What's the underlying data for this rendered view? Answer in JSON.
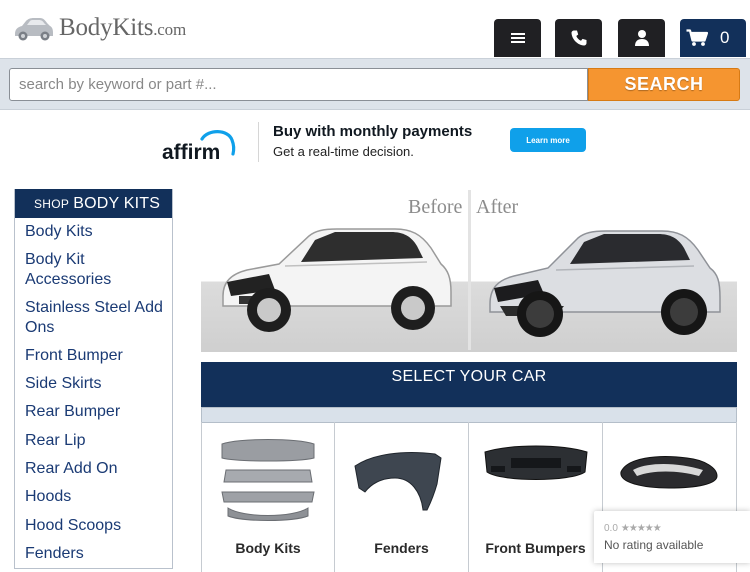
{
  "header": {
    "logo_text_main": "BodyKits",
    "logo_text_domain": ".com",
    "menu_icon": "hamburger-menu-icon",
    "phone_icon": "phone-icon",
    "account_icon": "user-icon",
    "cart_icon": "shopping-cart-icon",
    "cart_count": "0",
    "dark_button_color": "#202023",
    "cart_button_color": "#12305a"
  },
  "search": {
    "placeholder": "search by keyword or part #...",
    "value": "",
    "button_label": "SEARCH",
    "button_color": "#f59530"
  },
  "affirm_banner": {
    "logo_text": "affirm",
    "headline": "Buy with monthly payments",
    "subtext": "Get a real-time decision.",
    "learn_more_label": "Learn more"
  },
  "sidebar": {
    "title_small": "SHOP",
    "title_large": "BODY KITS",
    "items": [
      "Body Kits",
      "Body Kit Accessories",
      "Stainless Steel Add Ons",
      "Front Bumper",
      "Side Skirts",
      "Rear Bumper",
      "Rear Lip",
      "Rear Add On",
      "Hoods",
      "Hood Scoops",
      "Fenders"
    ]
  },
  "hero": {
    "before_label": "Before",
    "after_label": "After"
  },
  "select_car": {
    "label": "SELECT YOUR CAR"
  },
  "products": [
    {
      "name": "Body Kits",
      "icon": "body-kit-image"
    },
    {
      "name": "Fenders",
      "icon": "fender-image"
    },
    {
      "name": "Front Bumpers",
      "icon": "front-bumper-image"
    },
    {
      "name": "",
      "icon": "hood-scoop-image"
    }
  ],
  "rating_widget": {
    "score": "0.0",
    "stars": "★★★★★",
    "text": "No rating available"
  },
  "colors": {
    "brand_navy": "#12305a",
    "link_blue": "#1a3a74",
    "accent_orange": "#f59530",
    "affirm_blue": "#0fa0ea"
  }
}
